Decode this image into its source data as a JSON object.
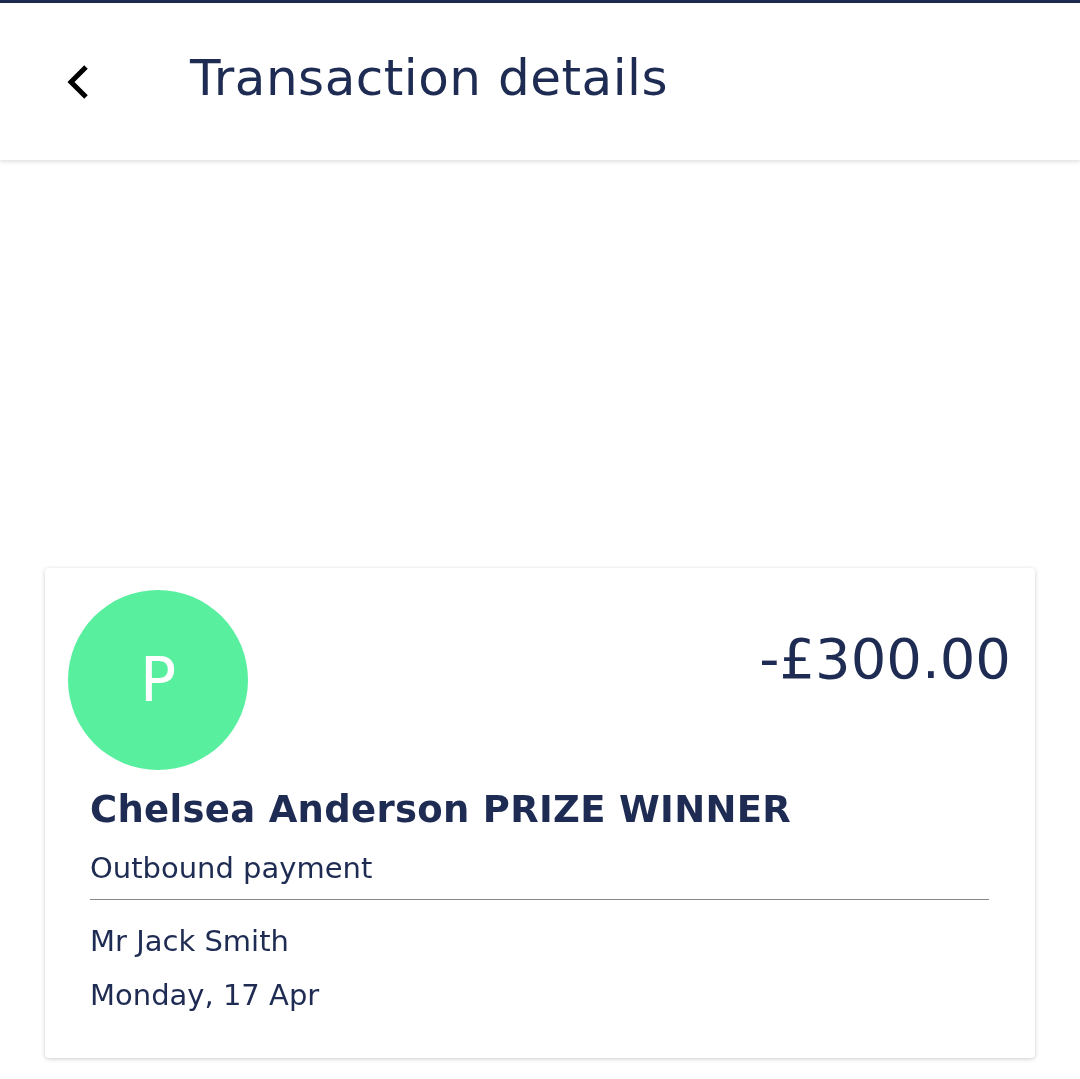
{
  "header": {
    "title": "Transaction details"
  },
  "transaction": {
    "avatar_initial": "P",
    "amount": "-£300.00",
    "name": "Chelsea Anderson PRIZE WINNER",
    "type": "Outbound payment",
    "counterparty": "Mr Jack Smith",
    "date": "Monday, 17 Apr"
  }
}
